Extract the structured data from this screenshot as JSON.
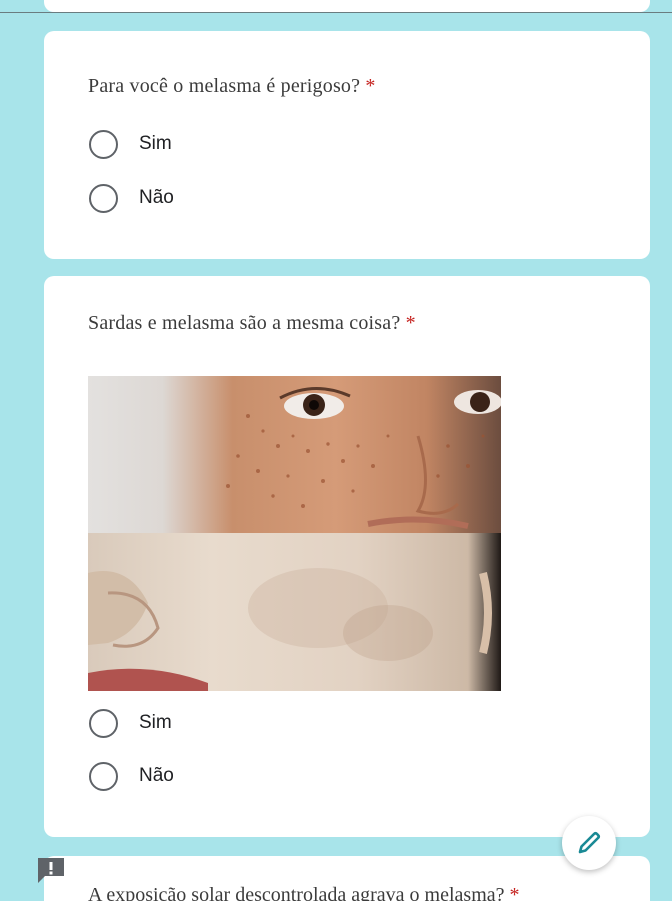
{
  "questions": [
    {
      "text": "Para você o melasma é perigoso?",
      "required_mark": "*",
      "options": [
        "Sim",
        "Não"
      ]
    },
    {
      "text": "Sardas e melasma são a mesma coisa?",
      "required_mark": "*",
      "options": [
        "Sim",
        "Não"
      ]
    }
  ],
  "partial_question": {
    "text": "A exposição solar descontrolada agrava o melasma?",
    "required_mark": "*"
  },
  "icons": {
    "fab": "pencil-icon",
    "feedback": "report-feedback-icon"
  },
  "colors": {
    "background": "#a8e4ea",
    "required": "#c5221f",
    "fab_icon": "#1a8a95"
  }
}
